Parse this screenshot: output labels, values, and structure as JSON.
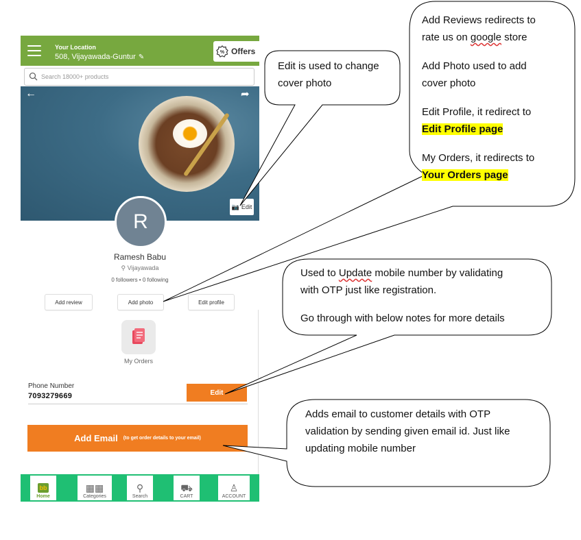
{
  "app": {
    "location_label": "Your Location",
    "location_value": "508, Vijayawada-Guntur",
    "offers_label": "Offers",
    "search_placeholder": "Search 18000+ products"
  },
  "cover": {
    "edit_label": "Edit"
  },
  "profile": {
    "avatar_initial": "R",
    "name": "Ramesh Babu",
    "city": "Vijayawada",
    "followers_text": "0 followers • 0 following"
  },
  "actions": {
    "add_review": "Add review",
    "add_photo": "Add photo",
    "edit_profile": "Edit profile"
  },
  "orders": {
    "label": "My Orders"
  },
  "phone": {
    "label": "Phone Number",
    "value": "7093279669",
    "edit_label": "Edit"
  },
  "email": {
    "button_label": "Add Email",
    "button_hint": "(to get order details to your email)"
  },
  "nav": {
    "home": "Home",
    "categories": "Categories",
    "search": "Search",
    "cart": "CART",
    "account": "ACCOUNT"
  },
  "callouts": {
    "cover_edit": {
      "line1": "Edit is used to change",
      "line2": "cover photo"
    },
    "profile_actions": {
      "p1_a": "Add Reviews redirects to",
      "p1_b_pre": "rate us on ",
      "p1_b_word": "google",
      "p1_b_post": " store",
      "p2_a": "Add Photo used to add",
      "p2_b": "cover photo",
      "p3_a": "Edit Profile, it redirect to",
      "p3_b": "Edit Profile page",
      "p4_a": "My Orders, it redirects to",
      "p4_b": "Your Orders page"
    },
    "phone_edit": {
      "l1_pre": "Used to ",
      "l1_word": "Update",
      "l1_post": " mobile number by validating",
      "l2": "with OTP just like registration.",
      "l3": "Go through with below notes for more details"
    },
    "email_add": {
      "l1": "Adds email to customer details with OTP",
      "l2": "validation by sending given email id.  Just like",
      "l3": "updating mobile number"
    }
  },
  "colors": {
    "header_green": "#77a83f",
    "accent_orange": "#f07d21",
    "nav_green": "#1fbf73",
    "highlight": "#ffff00"
  }
}
